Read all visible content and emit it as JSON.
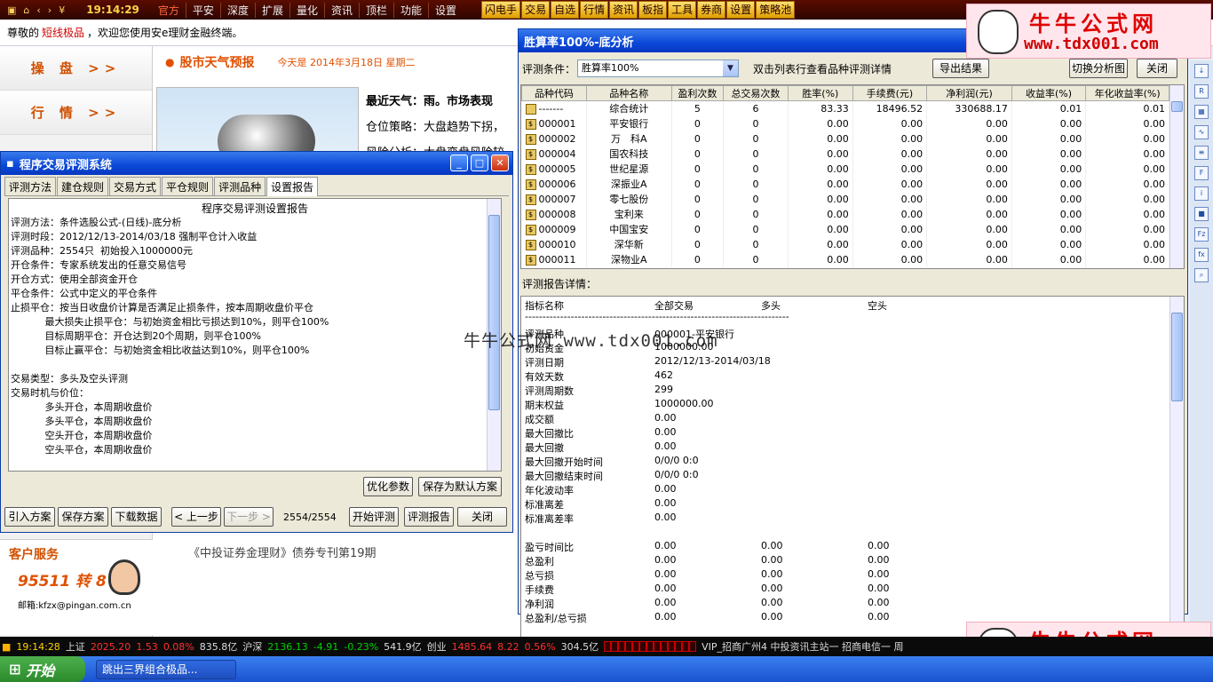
{
  "topbar": {
    "time": "19:14:29",
    "menu": [
      "官方",
      "平安",
      "深度",
      "扩展",
      "量化",
      "资讯",
      "顶栏",
      "功能",
      "设置"
    ],
    "buttons": [
      "闪电手",
      "交易",
      "自选",
      "行情",
      "资讯",
      "板指",
      "工具",
      "券商",
      "设置",
      "策略池"
    ]
  },
  "welcome": {
    "prefix": "尊敬的",
    "user": "短线极品",
    "suffix": "，欢迎您使用安e理财金融终端。"
  },
  "leftnav": {
    "items": [
      "操 盘 >>",
      "行 情 >>"
    ]
  },
  "weather": {
    "title": "股市天气预报",
    "date": "今天是 2014年3月18日 星期二",
    "lines": [
      "最近天气：雨。市场表现",
      "仓位策略：大盘趋势下拐，",
      "风险分析：大盘变盘风险较"
    ]
  },
  "news": "《中投证券金理财》债券专刊第19期",
  "service": {
    "title": "客户服务",
    "tel": "95511 转 8",
    "email": "邮箱:kfzx@pingan.com.cn"
  },
  "eval_dialog": {
    "title": "程序交易评测系统",
    "tabs": [
      "评测方法",
      "建仓规则",
      "交易方式",
      "平仓规则",
      "评测品种",
      "设置报告"
    ],
    "report_title": "程序交易评测设置报告",
    "report_lines": [
      "评测方法：条件选股公式-(日线)-底分析",
      "评测时段：2012/12/13-2014/03/18 强制平仓计入收益",
      "评测品种：2554只  初始投入1000000元",
      "开仓条件：专家系统发出的任意交易信号",
      "开仓方式：使用全部资金开仓",
      "平仓条件：公式中定义的平仓条件",
      "止损平仓：按当日收盘价计算是否满足止损条件，按本周期收盘价平仓",
      "           最大损失止损平仓：与初始资金相比亏损达到10%，则平仓100%",
      "           目标周期平仓：开仓达到20个周期，则平仓100%",
      "           目标止赢平仓：与初始资金相比收益达到10%，则平仓100%",
      "",
      "交易类型：多头及空头评测",
      "交易时机与价位：",
      "           多头开仓，本周期收盘价",
      "           多头平仓，本周期收盘价",
      "           空头开仓，本周期收盘价",
      "           空头平仓，本周期收盘价"
    ],
    "btn_optimize": "优化参数",
    "btn_save_default": "保存为默认方案",
    "btn_import": "引入方案",
    "btn_save": "保存方案",
    "btn_download": "下载数据",
    "btn_prev": "< 上一步",
    "btn_next": "下一步 >",
    "progress": "2554/2554",
    "btn_start": "开始评测",
    "btn_report": "评测报告",
    "btn_close": "关闭"
  },
  "result_dialog": {
    "title": "胜算率100%-底分析",
    "cond_label": "评测条件：",
    "cond_value": "胜算率100%",
    "hint": "双击列表行查看品种评测详情",
    "btn_export": "导出结果",
    "btn_switch": "切换分析图",
    "btn_close": "关闭",
    "columns": [
      "品种代码",
      "品种名称",
      "盈利次数",
      "总交易次数",
      "胜率(%)",
      "手续费(元)",
      "净利润(元)",
      "收益率(%)",
      "年化收益率(%)"
    ],
    "rows": [
      [
        "-------",
        "综合统计",
        "5",
        "6",
        "83.33",
        "18496.52",
        "330688.17",
        "0.01",
        "0.01"
      ],
      [
        "000001",
        "平安银行",
        "0",
        "0",
        "0.00",
        "0.00",
        "0.00",
        "0.00",
        "0.00"
      ],
      [
        "000002",
        "万　科A",
        "0",
        "0",
        "0.00",
        "0.00",
        "0.00",
        "0.00",
        "0.00"
      ],
      [
        "000004",
        "国农科技",
        "0",
        "0",
        "0.00",
        "0.00",
        "0.00",
        "0.00",
        "0.00"
      ],
      [
        "000005",
        "世纪星源",
        "0",
        "0",
        "0.00",
        "0.00",
        "0.00",
        "0.00",
        "0.00"
      ],
      [
        "000006",
        "深振业A",
        "0",
        "0",
        "0.00",
        "0.00",
        "0.00",
        "0.00",
        "0.00"
      ],
      [
        "000007",
        "零七股份",
        "0",
        "0",
        "0.00",
        "0.00",
        "0.00",
        "0.00",
        "0.00"
      ],
      [
        "000008",
        "宝利来",
        "0",
        "0",
        "0.00",
        "0.00",
        "0.00",
        "0.00",
        "0.00"
      ],
      [
        "000009",
        "中国宝安",
        "0",
        "0",
        "0.00",
        "0.00",
        "0.00",
        "0.00",
        "0.00"
      ],
      [
        "000010",
        "深华新",
        "0",
        "0",
        "0.00",
        "0.00",
        "0.00",
        "0.00",
        "0.00"
      ],
      [
        "000011",
        "深物业A",
        "0",
        "0",
        "0.00",
        "0.00",
        "0.00",
        "0.00",
        "0.00"
      ]
    ],
    "detail_label": "评测报告详情：",
    "detail_headers": [
      "指标名称",
      "全部交易",
      "多头",
      "空头"
    ],
    "detail_separator": "---------------------------------------------------------------------------",
    "detail_rows": [
      [
        "评测品种",
        "000001-平安银行",
        "",
        ""
      ],
      [
        "初始资金",
        "1000000.00",
        "",
        ""
      ],
      [
        "评测日期",
        "2012/12/13-2014/03/18",
        "",
        ""
      ],
      [
        "有效天数",
        "462",
        "",
        ""
      ],
      [
        "评测周期数",
        "299",
        "",
        ""
      ],
      [
        "期末权益",
        "1000000.00",
        "",
        ""
      ],
      [
        "成交额",
        "0.00",
        "",
        ""
      ],
      [
        "最大回撤比",
        "0.00",
        "",
        ""
      ],
      [
        "最大回撤",
        "0.00",
        "",
        ""
      ],
      [
        "最大回撤开始时间",
        "0/0/0 0:0",
        "",
        ""
      ],
      [
        "最大回撤结束时间",
        "0/0/0 0:0",
        "",
        ""
      ],
      [
        "年化波动率",
        "0.00",
        "",
        ""
      ],
      [
        "标准离差",
        "0.00",
        "",
        ""
      ],
      [
        "标准离差率",
        "0.00",
        "",
        ""
      ],
      [
        "",
        "",
        "",
        ""
      ],
      [
        "盈亏时间比",
        "0.00",
        "0.00",
        "0.00"
      ],
      [
        "总盈利",
        "0.00",
        "0.00",
        "0.00"
      ],
      [
        "总亏损",
        "0.00",
        "0.00",
        "0.00"
      ],
      [
        "手续费",
        "0.00",
        "0.00",
        "0.00"
      ],
      [
        "净利润",
        "0.00",
        "0.00",
        "0.00"
      ],
      [
        "总盈利/总亏损",
        "0.00",
        "0.00",
        "0.00"
      ]
    ]
  },
  "watermark": {
    "cn": "牛牛公式网",
    "url": "www.tdx001.com",
    "mid": "牛牛公式网 www.tdx001.com"
  },
  "status": {
    "time": "19:14:28",
    "sh_label": "上证",
    "sh_val": "2025.20",
    "sh_chg": "1.53",
    "sh_pct": "0.08%",
    "sh_amt": "835.8亿",
    "sz_label": "沪深",
    "sz_val": "2136.13",
    "sz_chg": "-4.91",
    "sz_pct": "-0.23%",
    "sz_amt": "541.9亿",
    "cy_label": "创业",
    "cy_val": "1485.64",
    "cy_chg": "8.22",
    "cy_pct": "0.56%",
    "cy_amt": "304.5亿",
    "server": "VIP_招商广州4  中投资讯主站一  招商电信一  周"
  },
  "taskbar": {
    "start": "开始",
    "task": "跳出三界组合极品..."
  }
}
